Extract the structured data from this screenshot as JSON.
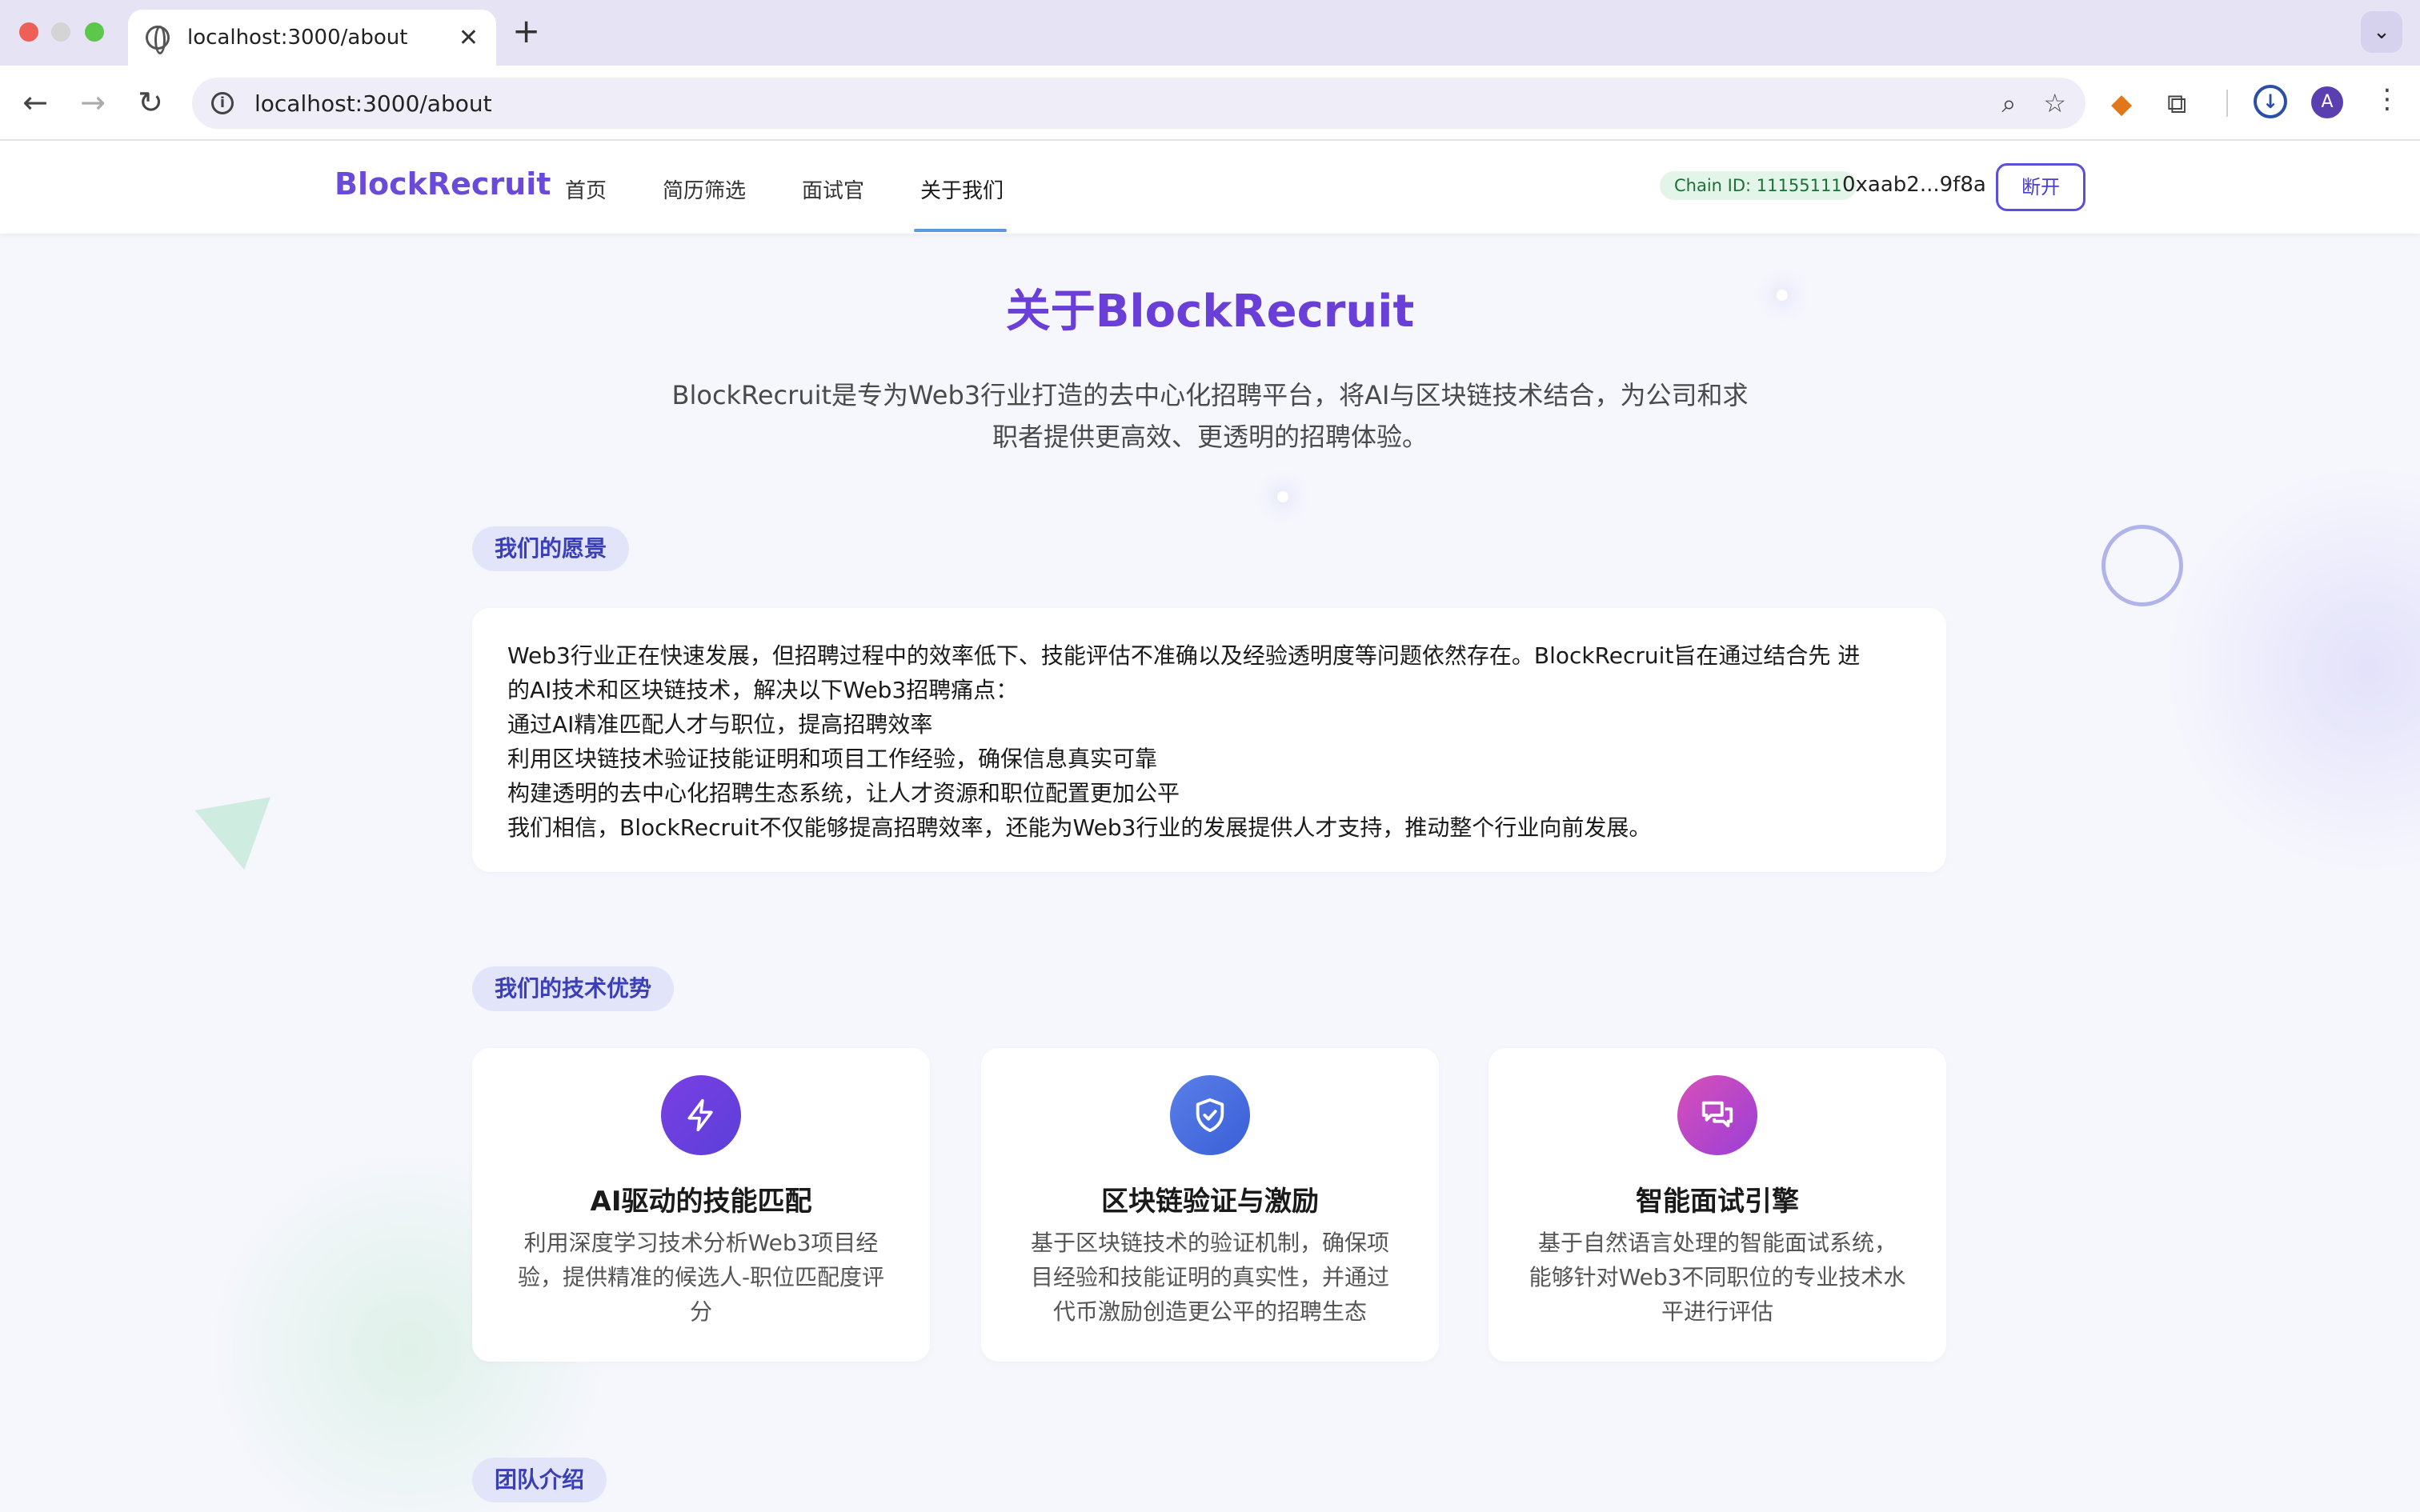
{
  "browser": {
    "tab_title": "localhost:3000/about",
    "url": "localhost:3000/about",
    "profile_initial": "A"
  },
  "site": {
    "brand": "BlockRecruit",
    "nav": [
      "首页",
      "简历筛选",
      "面试官",
      "关于我们"
    ],
    "active_nav": "关于我们",
    "chain_badge": "Chain ID: 11155111",
    "wallet": "0xaab2...9f8a",
    "disconnect_label": "断开"
  },
  "hero": {
    "title": "关于BlockRecruit",
    "description_lines": [
      "BlockRecruit是专为Web3行业打造的去中心化招聘平台，将AI与区块链技术结合，为公司和求",
      "职者提供更高效、更透明的招聘体验。"
    ]
  },
  "vision": {
    "heading": "我们的愿景",
    "lines": [
      "Web3行业正在快速发展，但招聘过程中的效率低下、技能评估不准确以及经验透明度等问题依然存在。BlockRecruit旨在通过结合先 进",
      "的AI技术和区块链技术，解决以下Web3招聘痛点：",
      "通过AI精准匹配人才与职位，提高招聘效率",
      "利用区块链技术验证技能证明和项目工作经验，确保信息真实可靠",
      "构建透明的去中心化招聘生态系统，让人才资源和职位配置更加公平",
      "我们相信，BlockRecruit不仅能够提高招聘效率，还能为Web3行业的发展提供人才支持，推动整个行业向前发展。"
    ]
  },
  "tech": {
    "heading": "我们的技术优势",
    "features": [
      {
        "icon": "lightning-icon",
        "title": "AI驱动的技能匹配",
        "desc_lines": [
          "利用深度学习技术分析Web3项目经",
          "验，提供精准的候选人-职位匹配度评",
          "分"
        ]
      },
      {
        "icon": "shield-check-icon",
        "title": "区块链验证与激励",
        "desc_lines": [
          "基于区块链技术的验证机制，确保项",
          "目经验和技能证明的真实性，并通过",
          "代币激励创造更公平的招聘生态"
        ]
      },
      {
        "icon": "chat-bubbles-icon",
        "title": "智能面试引擎",
        "desc_lines": [
          "基于自然语言处理的智能面试系统，",
          "能够针对Web3不同职位的专业技术水",
          "平进行评估"
        ]
      }
    ]
  },
  "team": {
    "heading": "团队介绍"
  },
  "colors": {
    "brand": "#6a4ad8",
    "accent_pill_bg": "#e2e4fa",
    "page_bg": "#f6f7fd"
  }
}
